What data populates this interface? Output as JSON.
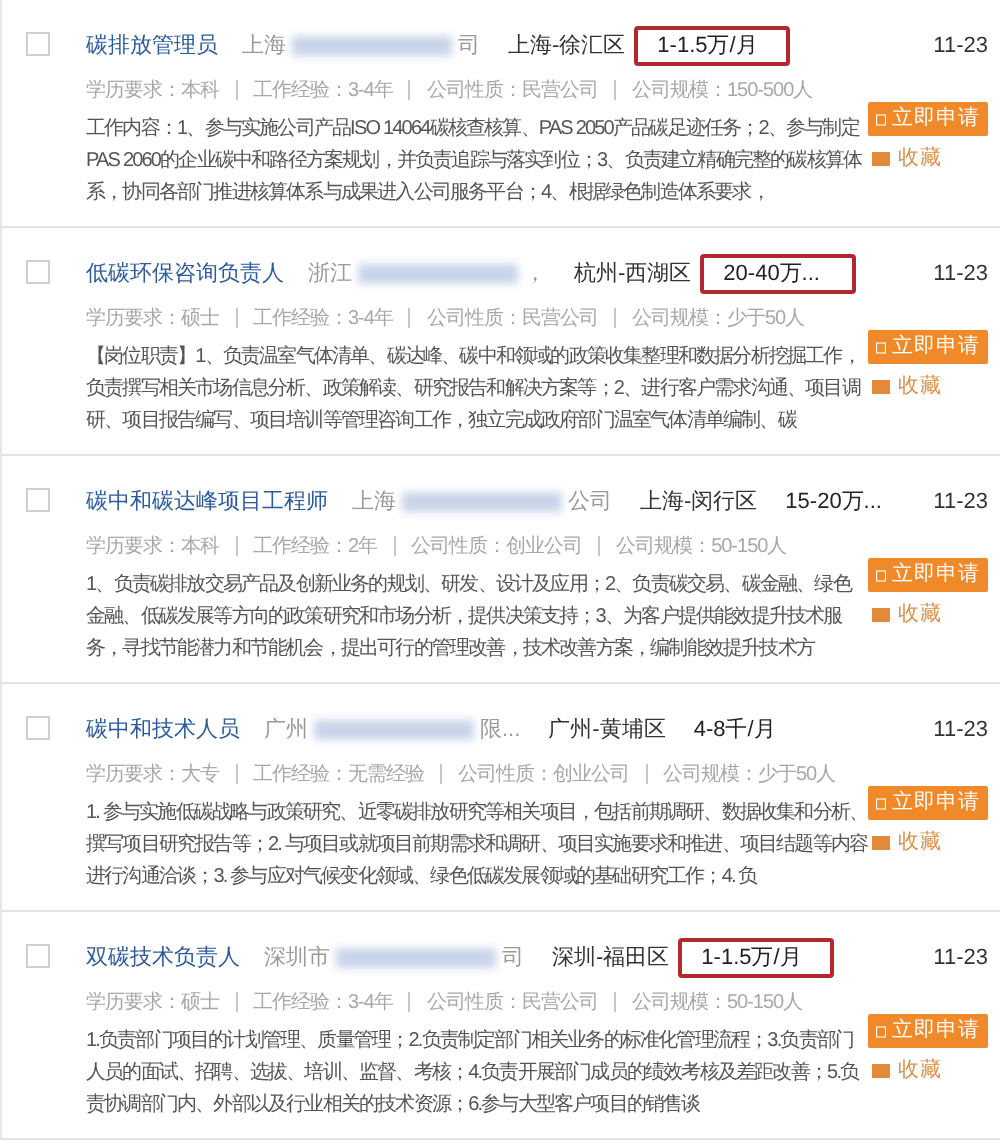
{
  "jobs": [
    {
      "checked": false,
      "title": "碳排放管理员",
      "company_start": "上海",
      "company_end": "司",
      "location": "上海-徐汇区",
      "salary": "1-1.5万/月",
      "highlighted": true,
      "date": "11-23",
      "meta": [
        "学历要求：本科",
        "工作经验：3-4年",
        "公司性质：民营公司",
        "公司规模：150-500人"
      ],
      "description": "工作内容：1、参与实施公司产品ISO 14064碳核查核算、PAS 2050产品碳足迹任务；2、参与制定PAS 2060的企业碳中和路径方案规划，并负责追踪与落实到位；3、负责建立精确完整的碳核算体系，协同各部门推进核算体系与成果进入公司服务平台；4、根据绿色制造体系要求，",
      "apply": "立即申请",
      "favorite": "收藏"
    },
    {
      "checked": false,
      "title": "低碳环保咨询负责人",
      "company_start": "浙江",
      "company_end": "，",
      "location": "杭州-西湖区",
      "salary": "20-40万...",
      "highlighted": true,
      "date": "11-23",
      "meta": [
        "学历要求：硕士",
        "工作经验：3-4年",
        "公司性质：民营公司",
        "公司规模：少于50人"
      ],
      "description": "【岗位职责】1、负责温室气体清单、碳达峰、碳中和领域的政策收集整理和数据分析挖掘工作，负责撰写相关市场信息分析、政策解读、研究报告和解决方案等；2、进行客户需求沟通、项目调研、项目报告编写、项目培训等管理咨询工作，独立完成政府部门温室气体清单编制、碳",
      "apply": "立即申请",
      "favorite": "收藏"
    },
    {
      "checked": false,
      "title": "碳中和碳达峰项目工程师",
      "company_start": "上海",
      "company_end": "公司",
      "location": "上海-闵行区",
      "salary": "15-20万...",
      "highlighted": false,
      "date": "11-23",
      "meta": [
        "学历要求：本科",
        "工作经验：2年",
        "公司性质：创业公司",
        "公司规模：50-150人"
      ],
      "description": "1、负责碳排放交易产品及创新业务的规划、研发、设计及应用；2、负责碳交易、碳金融、绿色金融、低碳发展等方向的政策研究和市场分析，提供决策支持；3、为客户提供能效提升技术服务，寻找节能潜力和节能机会，提出可行的管理改善，技术改善方案，编制能效提升技术方",
      "apply": "立即申请",
      "favorite": "收藏"
    },
    {
      "checked": false,
      "title": "碳中和技术人员",
      "company_start": "广州",
      "company_end": "限...",
      "location": "广州-黄埔区",
      "salary": "4-8千/月",
      "highlighted": false,
      "date": "11-23",
      "meta": [
        "学历要求：大专",
        "工作经验：无需经验",
        "公司性质：创业公司",
        "公司规模：少于50人"
      ],
      "description": "1. 参与实施低碳战略与政策研究、近零碳排放研究等相关项目，包括前期调研、数据收集和分析、撰写项目研究报告等；2. 与项目或就项目前期需求和调研、项目实施要求和推进、项目结题等内容进行沟通洽谈；3. 参与应对气候变化领域、绿色低碳发展领域的基础研究工作；4. 负",
      "apply": "立即申请",
      "favorite": "收藏"
    },
    {
      "checked": false,
      "title": "双碳技术负责人",
      "company_start": "深圳市",
      "company_end": "司",
      "location": "深圳-福田区",
      "salary": "1-1.5万/月",
      "highlighted": true,
      "date": "11-23",
      "meta": [
        "学历要求：硕士",
        "工作经验：3-4年",
        "公司性质：民营公司",
        "公司规模：50-150人"
      ],
      "description": "1.负责部门项目的计划管理、质量管理；2.负责制定部门相关业务的标准化管理流程；3.负责部门人员的面试、招聘、选拔、培训、监督、考核；4.负责开展部门成员的绩效考核及差距改善；5.负责协调部门内、外部以及行业相关的技术资源；6.参与大型客户项目的销售谈",
      "apply": "立即申请",
      "favorite": "收藏"
    }
  ]
}
